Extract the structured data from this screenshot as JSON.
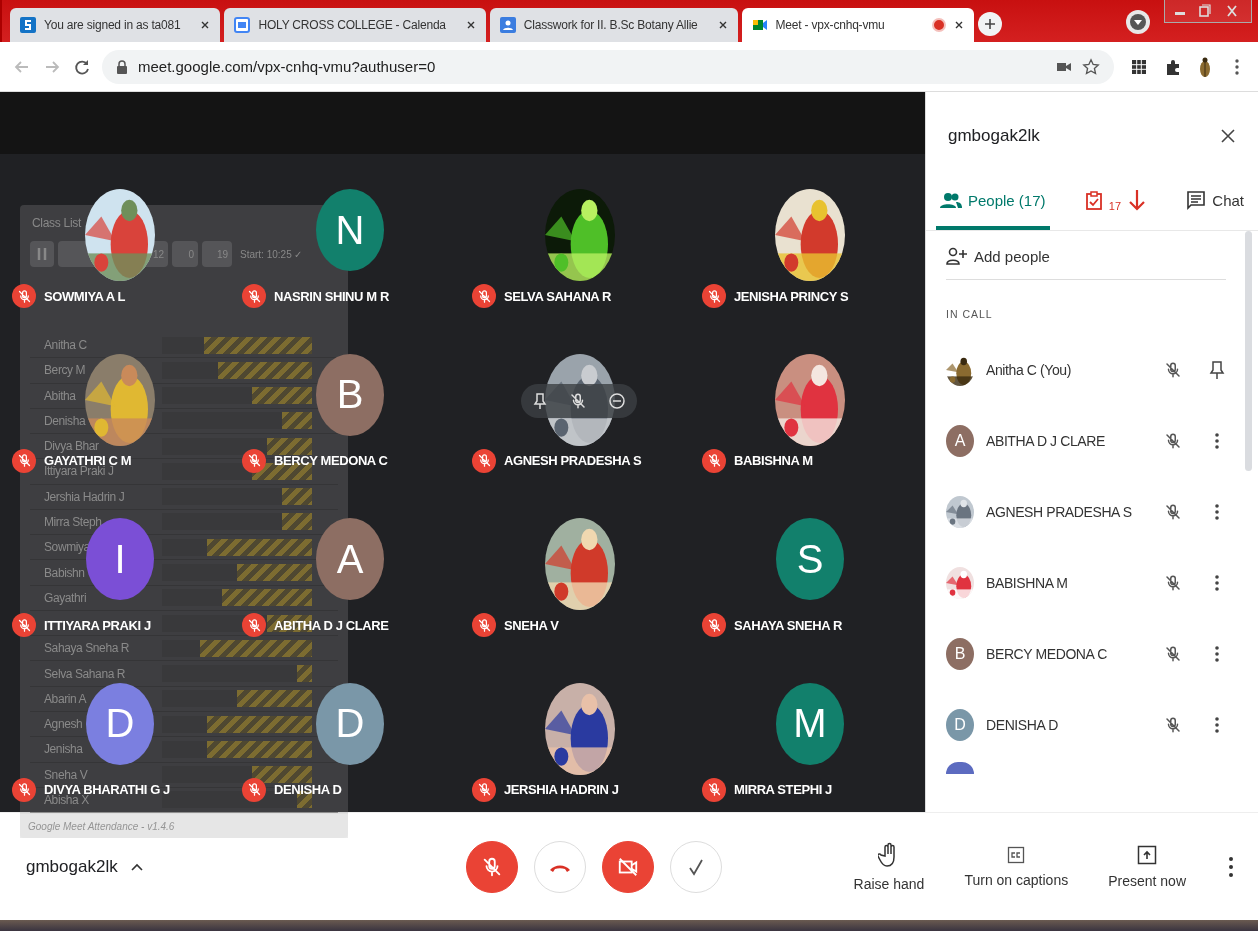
{
  "browser": {
    "tabs": [
      {
        "title": "You are signed in as ta081",
        "kind": "school",
        "selected": false,
        "recording": false
      },
      {
        "title": "HOLY CROSS COLLEGE - Calenda",
        "kind": "calendar",
        "selected": false,
        "recording": false
      },
      {
        "title": "Classwork for II. B.Sc Botany Allie",
        "kind": "classroom",
        "selected": false,
        "recording": false
      },
      {
        "title": "Meet - vpx-cnhq-vmu",
        "kind": "meet",
        "selected": true,
        "recording": true
      }
    ],
    "url": "meet.google.com/vpx-cnhq-vmu?authuser=0"
  },
  "tiles": [
    {
      "name": "SOWMIYA A L",
      "kind": "picture"
    },
    {
      "name": "NASRIN SHINU M R",
      "kind": "letter",
      "letter": "N",
      "color": "#12806c"
    },
    {
      "name": "SELVA SAHANA R",
      "kind": "picture"
    },
    {
      "name": "JENISHA PRINCY S",
      "kind": "picture"
    },
    {
      "name": "GAYATHRI C M",
      "kind": "picture"
    },
    {
      "name": "BERCY MEDONA C",
      "kind": "letter",
      "letter": "B",
      "color": "#8d6e63"
    },
    {
      "name": "AGNESH PRADESHA S",
      "kind": "picture",
      "hover_controls": true
    },
    {
      "name": "BABISHNA M",
      "kind": "picture"
    },
    {
      "name": "ITTIYARA PRAKI J",
      "kind": "letter",
      "letter": "I",
      "color": "#7b4fd6"
    },
    {
      "name": "ABITHA D J CLARE",
      "kind": "letter",
      "letter": "A",
      "color": "#8d6e63"
    },
    {
      "name": "SNEHA V",
      "kind": "picture"
    },
    {
      "name": "SAHAYA SNEHA R",
      "kind": "letter",
      "letter": "S",
      "color": "#12806c"
    },
    {
      "name": "DIVYA BHARATHI G J",
      "kind": "letter",
      "letter": "D",
      "color": "#7b7fe0"
    },
    {
      "name": "DENISHA D",
      "kind": "letter",
      "letter": "D",
      "color": "#7a97a8"
    },
    {
      "name": "JERSHIA HADRIN J",
      "kind": "picture"
    },
    {
      "name": "MIRRA STEPHI J",
      "kind": "letter",
      "letter": "M",
      "color": "#12806c"
    }
  ],
  "class_list": {
    "title": "Class List",
    "present": "12",
    "absent": "0",
    "unknown": "19",
    "start": "Start: 10:25 ✓",
    "rows": [
      {
        "name": "Anitha C",
        "level": 0.72
      },
      {
        "name": "Bercy M",
        "level": 0.63
      },
      {
        "name": "Abitha",
        "level": 0.4
      },
      {
        "name": "Denisha",
        "level": 0.2
      },
      {
        "name": "Divya Bhar",
        "level": 0.3
      },
      {
        "name": "Ittiyara Praki J",
        "level": 0.4
      },
      {
        "name": "Jershia Hadrin J",
        "level": 0.2
      },
      {
        "name": "Mirra Steph",
        "level": 0.2
      },
      {
        "name": "Sowmiya",
        "level": 0.7
      },
      {
        "name": "Babishn",
        "level": 0.5
      },
      {
        "name": "Gayathri",
        "level": 0.6
      },
      {
        "level": 0.3
      },
      {
        "name": "Sahaya Sneha R",
        "level": 0.75
      },
      {
        "name": "Selva Sahana R",
        "level": 0.1
      },
      {
        "name": "Abarin A",
        "level": 0.5
      },
      {
        "name": "Agnesh",
        "level": 0.7
      },
      {
        "name": "Jenisha",
        "level": 0.7
      },
      {
        "name": "Sneha V",
        "level": 0.4
      },
      {
        "name": "Abisha X",
        "level": 0.1
      }
    ],
    "footer": "Google Meet Attendance - v1.4.6"
  },
  "panel": {
    "title": "gmbogak2lk",
    "tabs": [
      {
        "label": "People (17)",
        "kind": "people",
        "selected": true
      },
      {
        "label": "17",
        "kind": "attendance",
        "selected": false
      },
      {
        "label": "Chat",
        "kind": "chat",
        "selected": false
      }
    ],
    "add_people": "Add people",
    "section": "IN CALL",
    "people": [
      {
        "name": "Anitha C (You)",
        "kind": "picture",
        "you": true
      },
      {
        "name": "ABITHA D J CLARE",
        "kind": "letter",
        "letter": "A",
        "color": "#8d6e63",
        "you": false
      },
      {
        "name": "AGNESH PRADESHA S",
        "kind": "picture",
        "you": false
      },
      {
        "name": "BABISHNA M",
        "kind": "picture",
        "you": false
      },
      {
        "name": "BERCY MEDONA C",
        "kind": "letter",
        "letter": "B",
        "color": "#8d6e63",
        "you": false
      },
      {
        "name": "DENISHA D",
        "kind": "letter",
        "letter": "D",
        "color": "#7a97a8",
        "you": false
      }
    ]
  },
  "bottom": {
    "meeting": "gmbogak2lk",
    "actions": [
      "Raise hand",
      "Turn on captions",
      "Present now"
    ]
  }
}
